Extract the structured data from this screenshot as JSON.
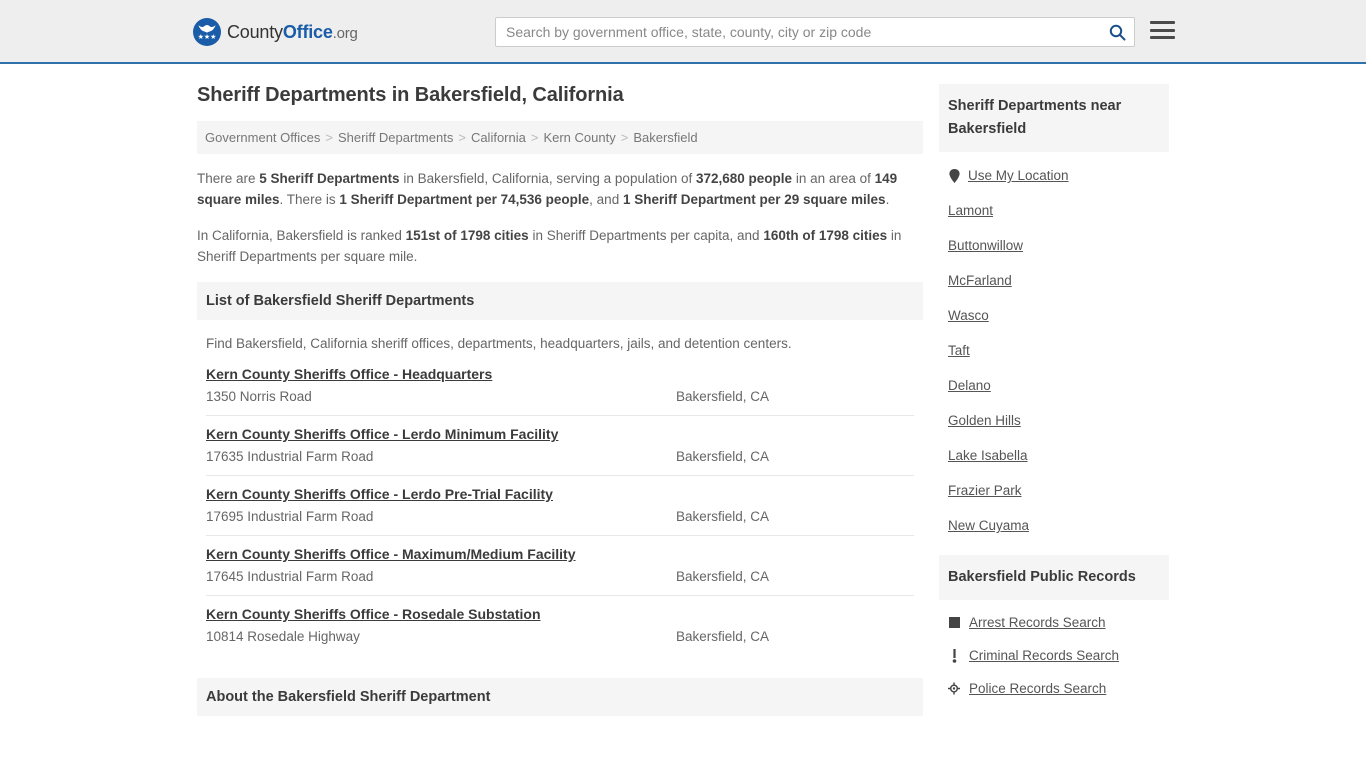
{
  "header": {
    "logo_name_part1": "County",
    "logo_name_part2": "Office",
    "logo_name_part3": ".org",
    "search_placeholder": "Search by government office, state, county, city or zip code",
    "search_value": "",
    "search_icon": "search-icon",
    "menu_icon": "hamburger-menu-icon",
    "accent_color": "#1a5ca8",
    "border_color": "#3071a9"
  },
  "main": {
    "title": "Sheriff Departments in Bakersfield, California",
    "breadcrumb": [
      {
        "label": "Government Offices"
      },
      {
        "label": "Sheriff Departments"
      },
      {
        "label": "California"
      },
      {
        "label": "Kern County"
      },
      {
        "label": "Bakersfield"
      }
    ],
    "breadcrumb_separator": ">",
    "intro": {
      "p1_a": "There are ",
      "p1_b1": "5 Sheriff Departments",
      "p1_b": " in Bakersfield, California, serving a population of ",
      "p1_b2": "372,680 people",
      "p1_c": " in an area of ",
      "p1_b3": "149 square miles",
      "p1_d": ". There is ",
      "p1_b4": "1 Sheriff Department per 74,536 people",
      "p1_e": ", and ",
      "p1_b5": "1 Sheriff Department per 29 square miles",
      "p1_f": ".",
      "p2_a": "In California, Bakersfield is ranked ",
      "p2_b1": "151st of 1798 cities",
      "p2_b": " in Sheriff Departments per capita, and ",
      "p2_b2": "160th of 1798 cities",
      "p2_c": " in Sheriff Departments per square mile."
    },
    "list_heading": "List of Bakersfield Sheriff Departments",
    "list_subtext": "Find Bakersfield, California sheriff offices, departments, headquarters, jails, and detention centers.",
    "listings": [
      {
        "name": "Kern County Sheriffs Office - Headquarters",
        "address": "1350 Norris Road",
        "city": "Bakersfield, CA"
      },
      {
        "name": "Kern County Sheriffs Office - Lerdo Minimum Facility",
        "address": "17635 Industrial Farm Road",
        "city": "Bakersfield, CA"
      },
      {
        "name": "Kern County Sheriffs Office - Lerdo Pre-Trial Facility",
        "address": "17695 Industrial Farm Road",
        "city": "Bakersfield, CA"
      },
      {
        "name": "Kern County Sheriffs Office - Maximum/Medium Facility",
        "address": "17645 Industrial Farm Road",
        "city": "Bakersfield, CA"
      },
      {
        "name": "Kern County Sheriffs Office - Rosedale Substation",
        "address": "10814 Rosedale Highway",
        "city": "Bakersfield, CA"
      }
    ],
    "about_heading": "About the Bakersfield Sheriff Department"
  },
  "sidebar": {
    "nearby_heading": "Sheriff Departments near Bakersfield",
    "nearby_items": [
      {
        "label": "Use My Location",
        "icon": "map-pin-icon"
      },
      {
        "label": "Lamont",
        "icon": ""
      },
      {
        "label": "Buttonwillow",
        "icon": ""
      },
      {
        "label": "McFarland",
        "icon": ""
      },
      {
        "label": "Wasco",
        "icon": ""
      },
      {
        "label": "Taft",
        "icon": ""
      },
      {
        "label": "Delano",
        "icon": ""
      },
      {
        "label": "Golden Hills",
        "icon": ""
      },
      {
        "label": "Lake Isabella",
        "icon": ""
      },
      {
        "label": "Frazier Park",
        "icon": ""
      },
      {
        "label": "New Cuyama",
        "icon": ""
      }
    ],
    "records_heading": "Bakersfield Public Records",
    "records_items": [
      {
        "label": "Arrest Records Search",
        "icon": "square-block-icon"
      },
      {
        "label": "Criminal Records Search",
        "icon": "exclamation-icon"
      },
      {
        "label": "Police Records Search",
        "icon": "badge-target-icon"
      }
    ]
  }
}
